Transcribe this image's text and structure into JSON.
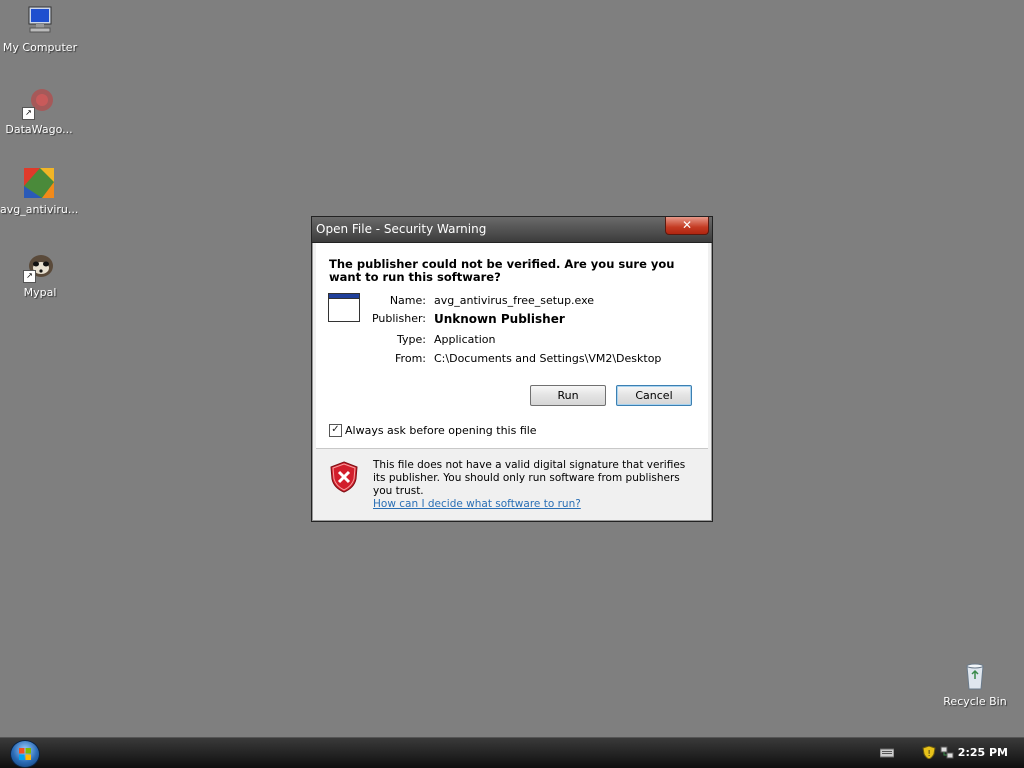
{
  "desktop": {
    "icons": [
      {
        "label": "My Computer"
      },
      {
        "label": "DataWago..."
      },
      {
        "label": "avg_antiviru..."
      },
      {
        "label": "Mypal"
      },
      {
        "label": "Recycle Bin"
      }
    ]
  },
  "dialog": {
    "title": "Open File - Security Warning",
    "close_glyph": "✕",
    "question": "The publisher could not be verified.  Are you sure you want to run this software?",
    "fields": {
      "name_label": "Name:",
      "name_value": "avg_antivirus_free_setup.exe",
      "publisher_label": "Publisher:",
      "publisher_value": "Unknown Publisher",
      "type_label": "Type:",
      "type_value": "Application",
      "from_label": "From:",
      "from_value": "C:\\Documents and Settings\\VM2\\Desktop"
    },
    "run_label": "Run",
    "cancel_label": "Cancel",
    "checkbox_label": "Always ask before opening this file",
    "checkbox_checked": true,
    "warning_text": "This file does not have a valid digital signature that verifies its publisher.  You should only run software from publishers you trust.",
    "help_link": "How can I decide what software to run?"
  },
  "taskbar": {
    "clock": "2:25 PM"
  },
  "colors": {
    "desktop_bg": "#7f7f7f",
    "titlebar": "#4a4a4a",
    "close_red": "#c43b23",
    "link_blue": "#2a6fb5",
    "shield_red": "#d21e2b"
  }
}
